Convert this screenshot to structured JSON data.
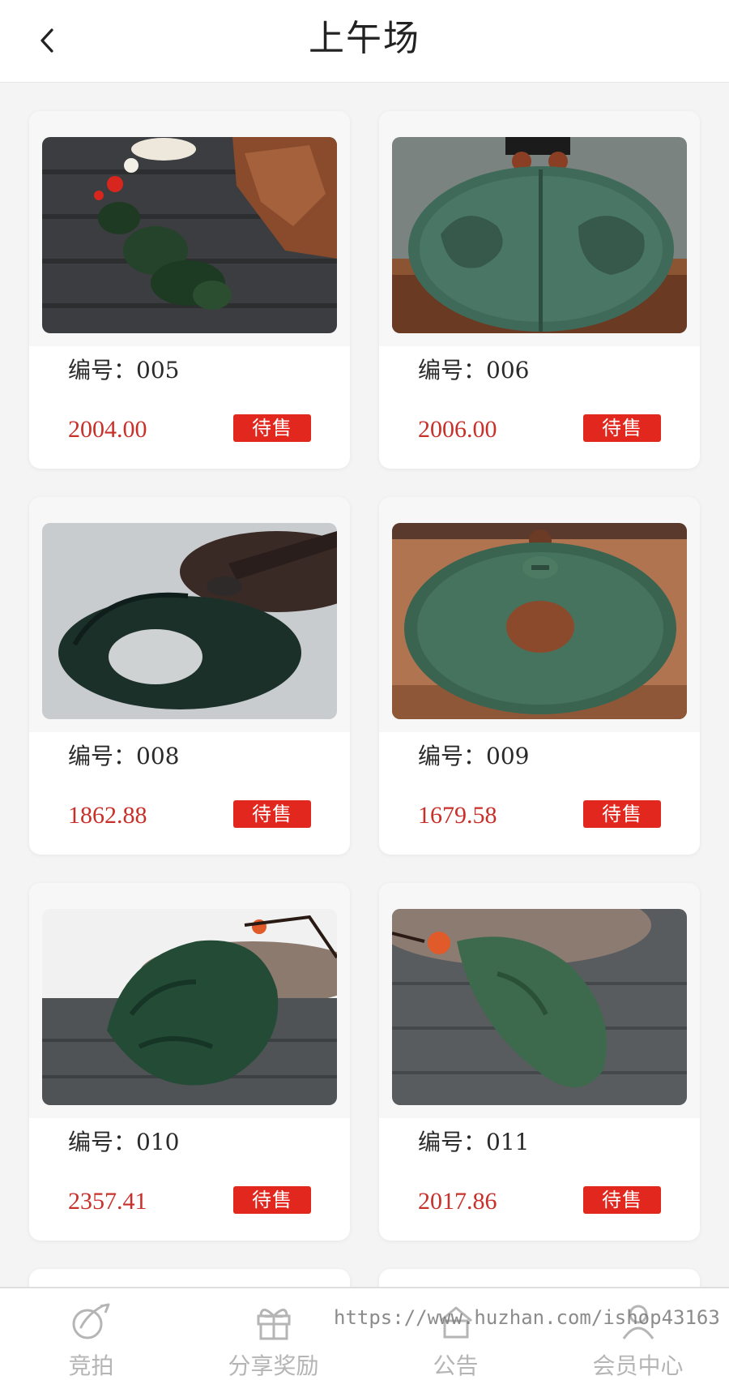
{
  "header": {
    "title": "上午场"
  },
  "items": [
    {
      "code_label": "编号：",
      "code": "005",
      "price": "2004.00",
      "status": "待售"
    },
    {
      "code_label": "编号：",
      "code": "006",
      "price": "2006.00",
      "status": "待售"
    },
    {
      "code_label": "编号：",
      "code": "008",
      "price": "1862.88",
      "status": "待售"
    },
    {
      "code_label": "编号：",
      "code": "009",
      "price": "1679.58",
      "status": "待售"
    },
    {
      "code_label": "编号：",
      "code": "010",
      "price": "2357.41",
      "status": "待售"
    },
    {
      "code_label": "编号：",
      "code": "011",
      "price": "2017.86",
      "status": "待售"
    }
  ],
  "tabbar": {
    "tabs": [
      {
        "label": "竞拍",
        "icon": "auction-icon"
      },
      {
        "label": "分享奖励",
        "icon": "gift-icon"
      },
      {
        "label": "公告",
        "icon": "home-notice-icon"
      },
      {
        "label": "会员中心",
        "icon": "user-icon"
      }
    ]
  },
  "watermark": "https://www.huzhan.com/ishop43163",
  "colors": {
    "price": "#c9302a",
    "status_bg": "#e2281e",
    "tab_inactive": "#b5b5b5"
  }
}
